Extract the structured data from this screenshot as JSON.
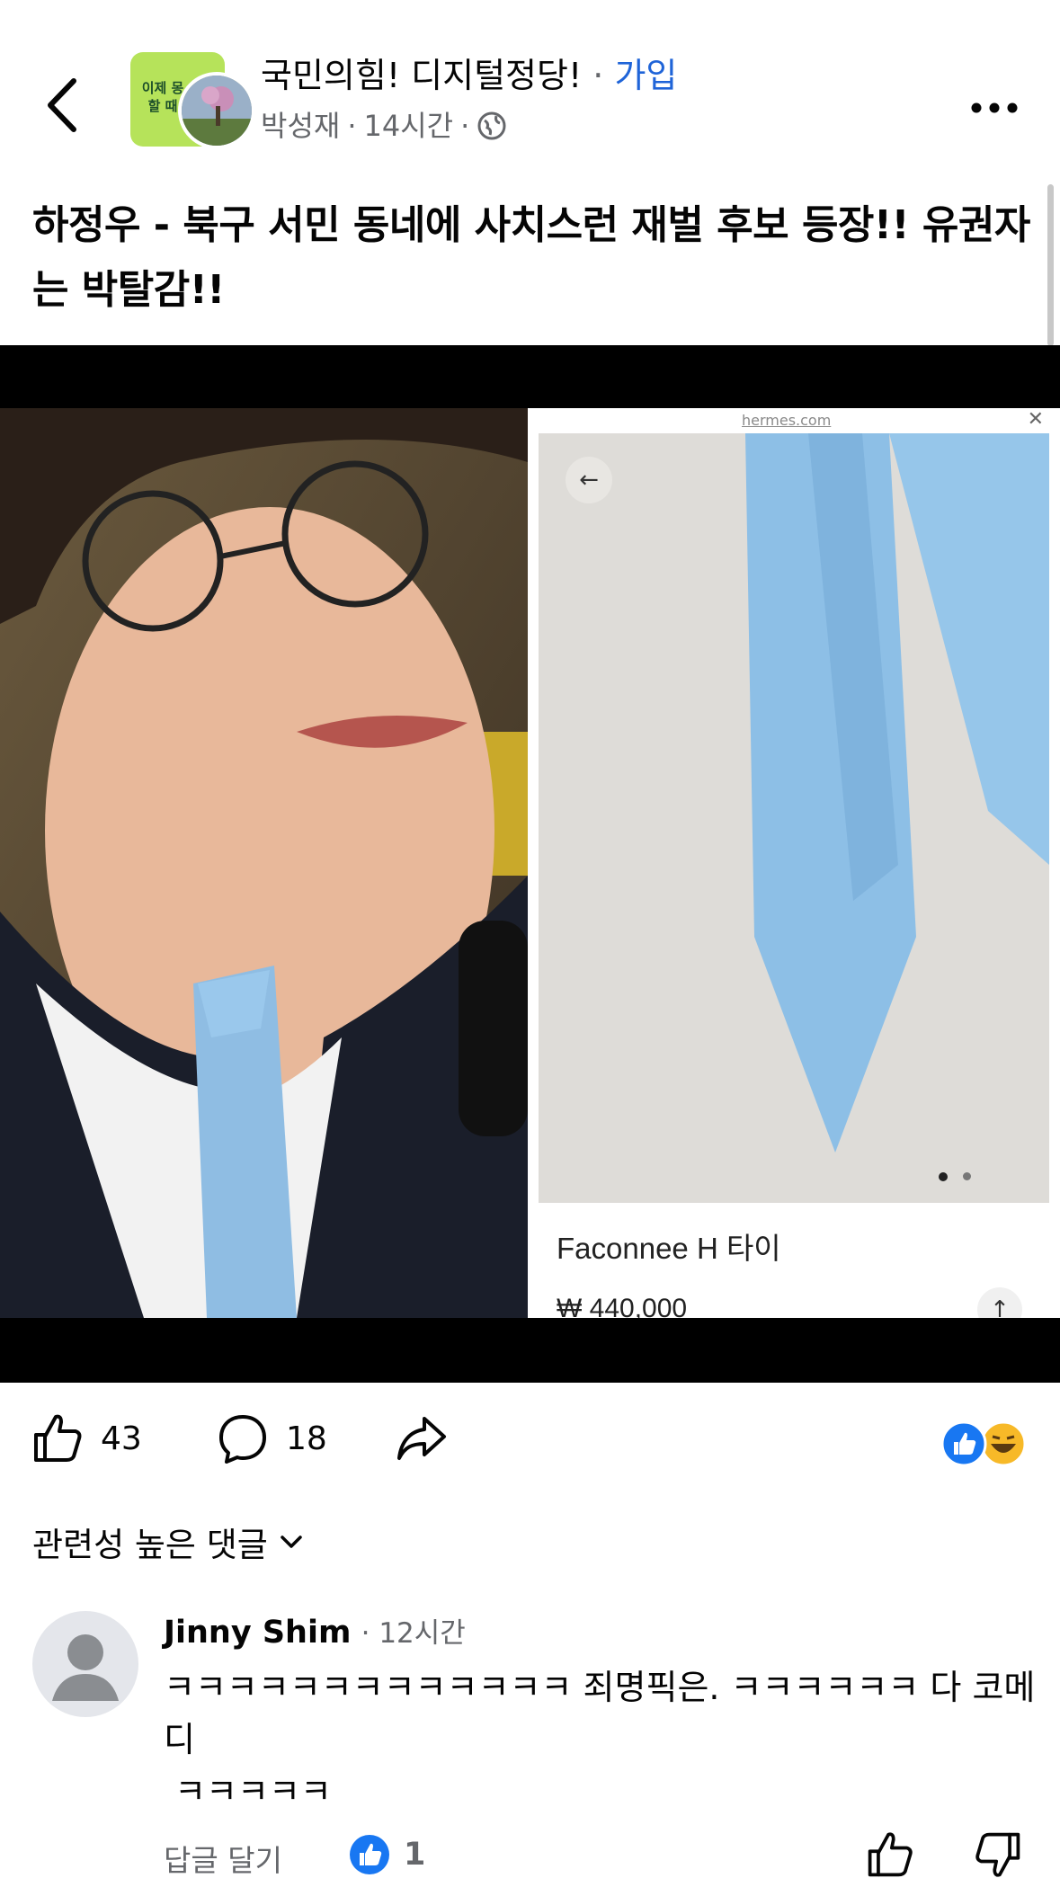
{
  "header": {
    "group_name": "국민의힘! 디지털정당!",
    "separator": "·",
    "join_label": "가입",
    "author": "박성재",
    "time": "14시간",
    "group_avatar_text": "이제 몽\n할 때"
  },
  "post": {
    "text": "하정우 - 북구 서민 동네에 사치스런 재벌 후보 등장!! 유권자는 박탈감!!"
  },
  "media": {
    "url_text": "hermes.com",
    "product_name": "Faconnee H 타이",
    "product_price": "₩ 440,000",
    "carousel_dots": 2,
    "active_dot": 1
  },
  "actions": {
    "like_count": "43",
    "comment_count": "18",
    "reactions": [
      "like-icon",
      "haha-icon"
    ]
  },
  "comments_sort": {
    "label": "관련성 높은 댓글"
  },
  "comment": {
    "author": "Jinny Shim",
    "time": "12시간",
    "body": "ㅋㅋㅋㅋㅋㅋㅋㅋㅋㅋㅋㅋㅋ 죄명픽은. ㅋㅋㅋㅋㅋㅋ 다 코메디\n ㅋㅋㅋㅋㅋ",
    "reply_label": "답글 달기",
    "like_count": "1"
  },
  "colors": {
    "accent": "#1f64d8",
    "secondary_text": "#65676b",
    "like_blue": "#1877f2"
  }
}
